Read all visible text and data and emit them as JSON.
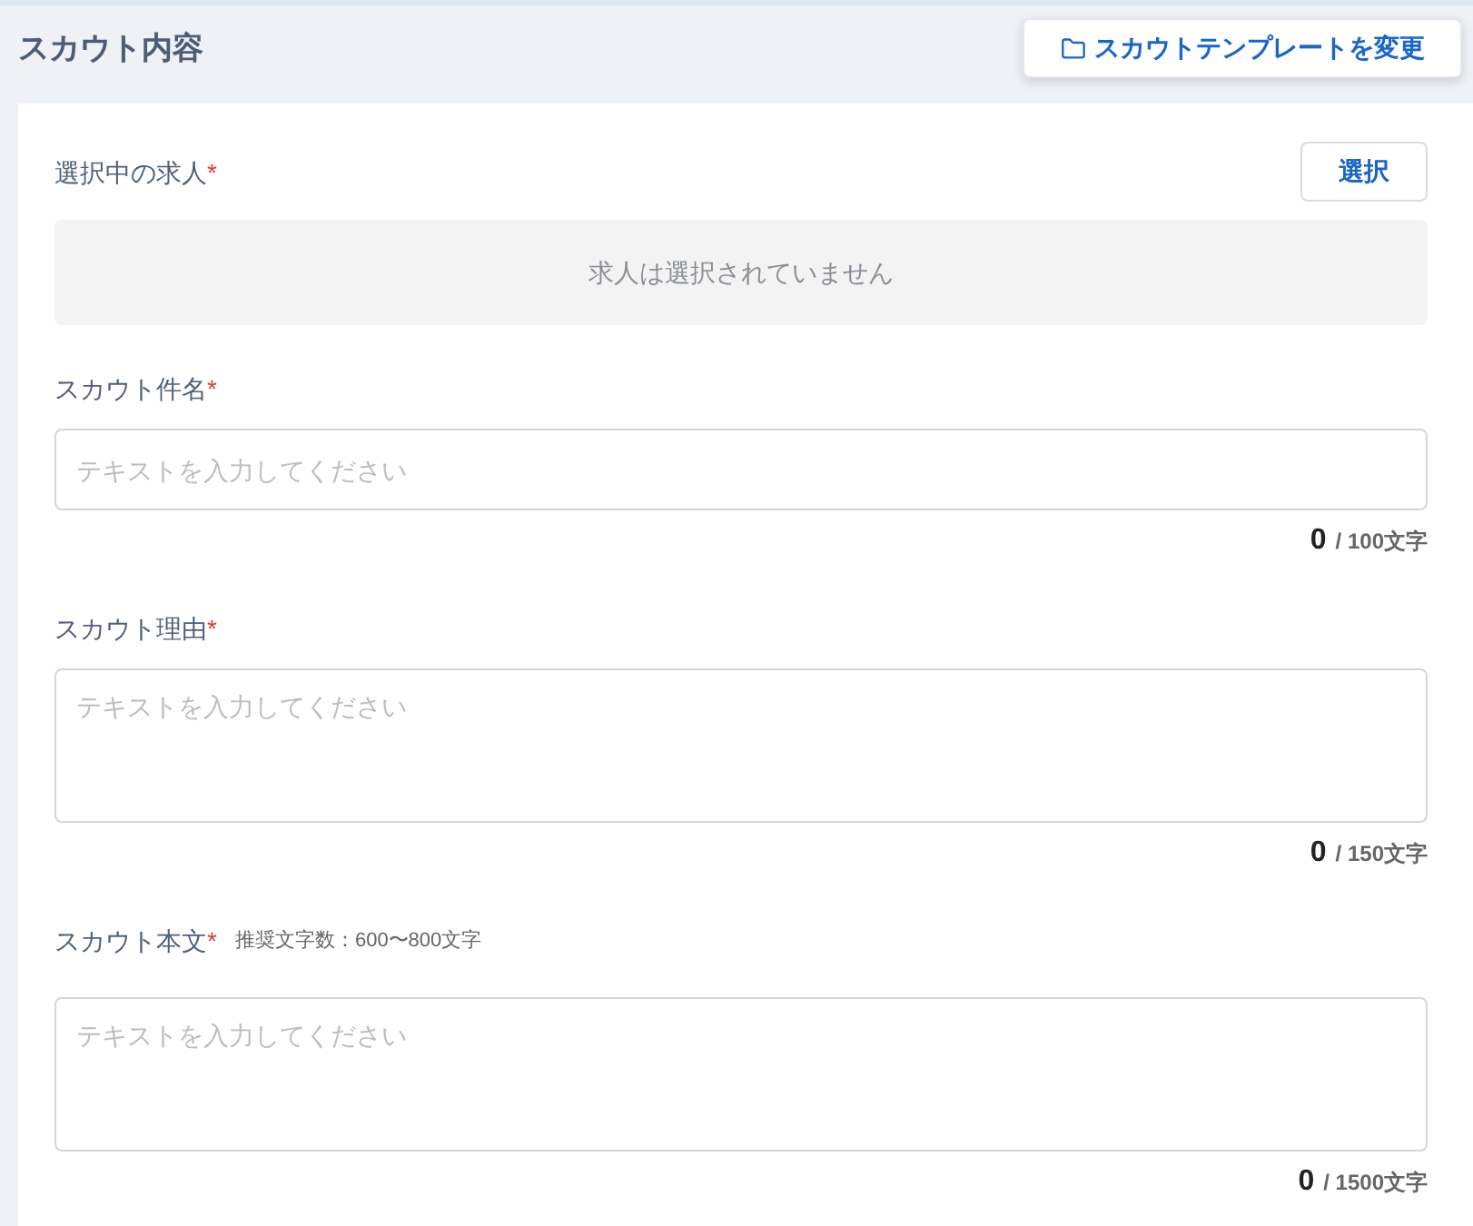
{
  "section_title": "スカウト内容",
  "template_button": {
    "label": "スカウトテンプレートを変更"
  },
  "fields": [
    {
      "kind": "job_select",
      "label": "選択中の求人",
      "required_mark": "*",
      "button": "選択",
      "empty_text": "求人は選択されていません"
    },
    {
      "kind": "input",
      "label": "スカウト件名",
      "required_mark": "*",
      "placeholder": "テキストを入力してください",
      "count": "0",
      "limit": "/ 100文字"
    },
    {
      "kind": "textarea",
      "label": "スカウト理由",
      "required_mark": "*",
      "placeholder": "テキストを入力してください",
      "count": "0",
      "limit": "/ 150文字"
    },
    {
      "kind": "textarea",
      "label": "スカウト本文",
      "required_mark": "*",
      "hint": "推奨文字数：600〜800文字",
      "placeholder": "テキストを入力してください",
      "count": "0",
      "limit": "/ 1500文字"
    }
  ]
}
